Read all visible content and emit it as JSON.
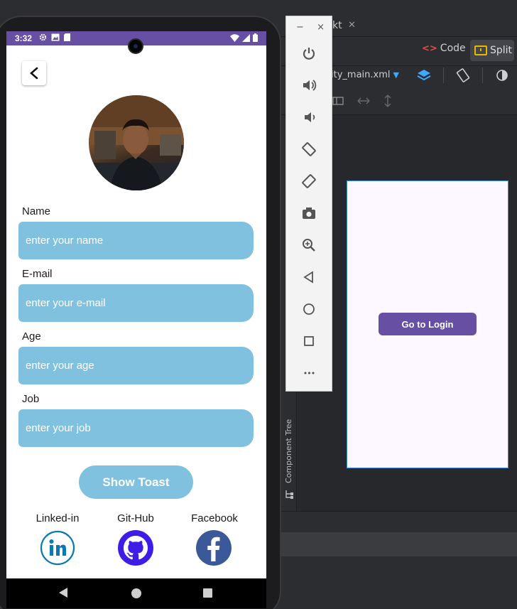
{
  "ide": {
    "tab_fragment": "kt",
    "tab_close": "✕",
    "code_label": "Code",
    "split_label": "Split",
    "file_dropdown": "ity_main.xml",
    "component_tree": "Component Tree"
  },
  "preview": {
    "button_label": "Go to Login",
    "button_color": "#6750a4"
  },
  "emulator": {
    "minimize": "−",
    "close": "×",
    "more": "•••"
  },
  "status_bar": {
    "time": "3:32"
  },
  "form": {
    "fields": [
      {
        "label": "Name",
        "placeholder": "enter your name"
      },
      {
        "label": "E-mail",
        "placeholder": "enter your e-mail"
      },
      {
        "label": "Age",
        "placeholder": "enter your age"
      },
      {
        "label": "Job",
        "placeholder": "enter your job"
      }
    ],
    "toast_button": "Show Toast",
    "input_color": "#80c1df"
  },
  "social": {
    "linkedin": "Linked-in",
    "github": "Git-Hub",
    "facebook": "Facebook"
  }
}
